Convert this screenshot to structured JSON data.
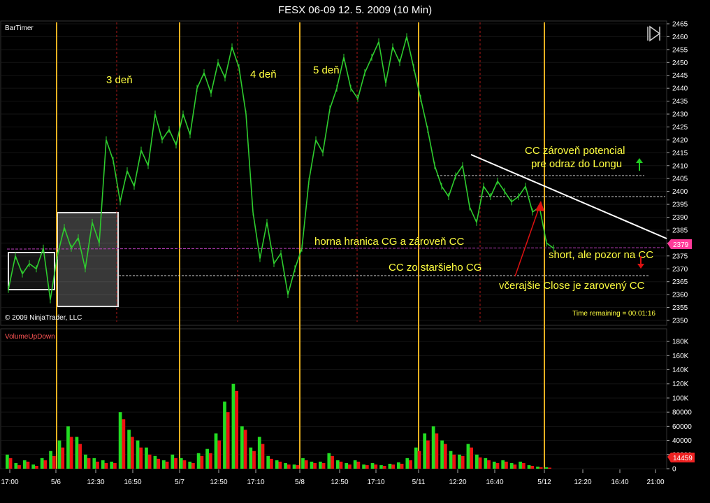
{
  "window": {
    "title": "FESX 06-09  12. 5. 2009 (10 Min)"
  },
  "colors": {
    "background": "#000000",
    "grid": "#1a1a1a",
    "price_line": "#2ecc2e",
    "session_line": "#e8b020",
    "day_marker": "#b01818",
    "volume_up": "#22dd22",
    "volume_down": "#ee1111",
    "trendline": "#ffffff",
    "level_line": "#d0d0d0",
    "magenta_level": "#c040c0",
    "annotation_text": "#ffff40",
    "price_badge": "#ff3a9a",
    "up_arrow": "#22cc22",
    "down_arrow": "#dd1111"
  },
  "panels": {
    "price": {
      "indicator_label": "BarTimer",
      "copyright": "© 2009 NinjaTrader, LLC",
      "time_remaining": "Time remaining = 00:01:16",
      "current_price_label": "2379"
    },
    "volume": {
      "indicator_label": "VolumeUpDown",
      "current_volume_label": "14459"
    }
  },
  "annotations": {
    "day3": "3 deň",
    "day4": "4 deň",
    "day5": "5 deň",
    "cc_potential_line1": "CC zároveň potencial",
    "cc_potential_line2": "pre odraz do Longu",
    "upper_cg": "horna hranica CG a zároveň CC",
    "cc_old_cg": "CC zo staršieho CG",
    "yesterday_close": "včerajšie Close je zarovený CC",
    "short_note": "short, ale pozor na CC"
  },
  "icons": {
    "play_pause": "play-pause-icon",
    "up_arrow": "up-arrow-icon",
    "down_arrow": "down-arrow-icon"
  },
  "chart_data": [
    {
      "type": "line",
      "title": "FESX 06-09  12. 5. 2009 (10 Min)",
      "ylim": [
        2350,
        2465
      ],
      "y_ticks": [
        "2465",
        "2460",
        "2455",
        "2450",
        "2445",
        "2440",
        "2435",
        "2430",
        "2425",
        "2420",
        "2415",
        "2410",
        "2405",
        "2400",
        "2395",
        "2390",
        "2385",
        "2380",
        "2375",
        "2370",
        "2365",
        "2360",
        "2355",
        "2350"
      ],
      "x_ticks": [
        "17:00",
        "5/6",
        "12:30",
        "16:50",
        "5/7",
        "12:50",
        "17:10",
        "5/8",
        "12:50",
        "17:10",
        "5/11",
        "12:20",
        "16:40",
        "5/12",
        "12:20",
        "16:40",
        "21:00"
      ],
      "series": [
        {
          "values": [
            2362,
            2375,
            2368,
            2372,
            2370,
            2378,
            2358,
            2375,
            2386,
            2378,
            2382,
            2370,
            2388,
            2380,
            2420,
            2412,
            2396,
            2408,
            2402,
            2416,
            2410,
            2430,
            2420,
            2424,
            2418,
            2430,
            2422,
            2440,
            2446,
            2438,
            2450,
            2444,
            2456,
            2448,
            2430,
            2392,
            2374,
            2388,
            2372,
            2376,
            2360,
            2370,
            2378,
            2404,
            2420,
            2415,
            2432,
            2440,
            2452,
            2440,
            2436,
            2446,
            2452,
            2458,
            2442,
            2456,
            2450,
            2460,
            2448,
            2436,
            2424,
            2410,
            2402,
            2398,
            2406,
            2410,
            2394,
            2388,
            2402,
            2398,
            2404,
            2400,
            2396,
            2398,
            2402,
            2392,
            2394,
            2380,
            2378
          ]
        }
      ],
      "levels": [
        2406,
        2398,
        2377,
        2367
      ]
    },
    {
      "type": "bar",
      "ylim": [
        0,
        190000
      ],
      "y_ticks": [
        "180K",
        "160K",
        "140K",
        "120K",
        "100K",
        "80000",
        "60000",
        "40000",
        "20000",
        "0"
      ],
      "series": [
        {
          "name": "up",
          "values": [
            20000,
            8000,
            12000,
            6000,
            15000,
            25000,
            40000,
            60000,
            45000,
            20000,
            15000,
            12000,
            10000,
            80000,
            55000,
            40000,
            30000,
            18000,
            12000,
            20000,
            15000,
            10000,
            22000,
            28000,
            50000,
            95000,
            120000,
            60000,
            30000,
            45000,
            18000,
            12000,
            8000,
            6000,
            15000,
            10000,
            10000,
            22000,
            12000,
            8000,
            12000,
            6000,
            8000,
            5000,
            7000,
            9000,
            15000,
            30000,
            50000,
            60000,
            40000,
            25000,
            20000,
            35000,
            20000,
            15000,
            10000,
            12000,
            8000,
            10000,
            5000,
            3000,
            2000
          ]
        },
        {
          "name": "down",
          "values": [
            15000,
            5000,
            10000,
            4000,
            12000,
            18000,
            30000,
            45000,
            35000,
            15000,
            10000,
            8000,
            8000,
            70000,
            45000,
            30000,
            20000,
            14000,
            10000,
            15000,
            12000,
            8000,
            18000,
            22000,
            40000,
            80000,
            110000,
            55000,
            25000,
            35000,
            14000,
            10000,
            6000,
            5000,
            12000,
            8000,
            8000,
            18000,
            10000,
            6000,
            10000,
            5000,
            6000,
            4000,
            6000,
            7000,
            12000,
            25000,
            40000,
            50000,
            35000,
            20000,
            18000,
            30000,
            16000,
            12000,
            8000,
            10000,
            6000,
            8000,
            4000,
            2000,
            1500
          ]
        }
      ]
    }
  ]
}
